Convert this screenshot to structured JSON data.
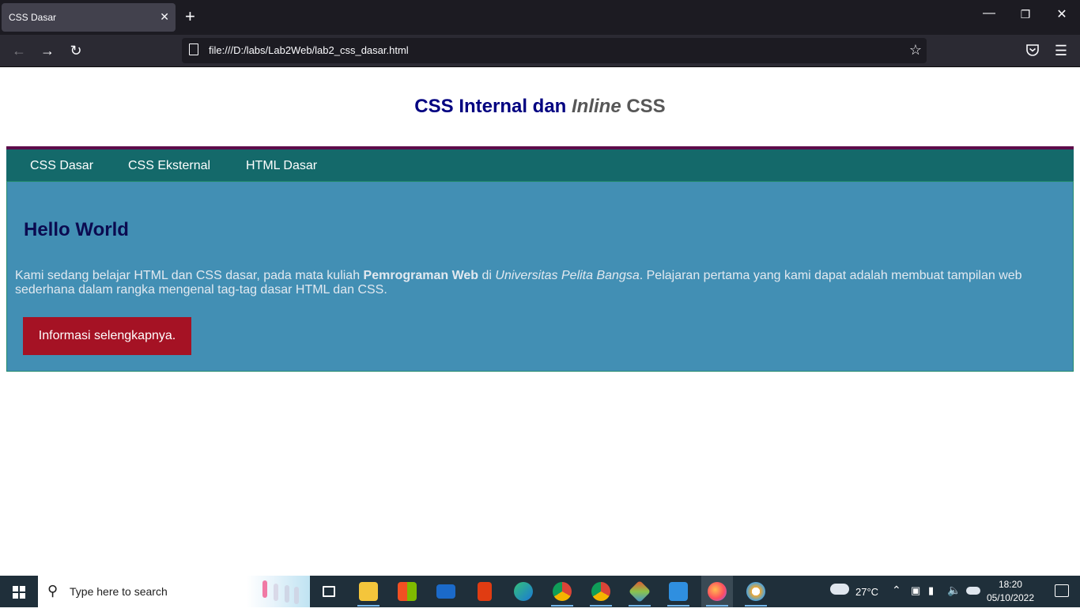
{
  "browser": {
    "tab_title": "CSS Dasar",
    "tab_close": "✕",
    "new_tab": "+",
    "url": "file:///D:/labs/Lab2Web/lab2_css_dasar.html",
    "icons": [
      "back-icon",
      "forward-icon",
      "reload-icon",
      "page-icon",
      "star-icon",
      "pocket-icon",
      "menu-icon",
      "minimize-icon",
      "restore-icon",
      "close-icon"
    ]
  },
  "page": {
    "heading_part1": "CSS Internal dan ",
    "heading_italic": "Inline",
    "heading_part2": " CSS",
    "menu": [
      {
        "label": "CSS Dasar"
      },
      {
        "label": "CSS Eksternal"
      },
      {
        "label": "HTML Dasar"
      }
    ],
    "content": {
      "title": "Hello World",
      "text_1": "Kami sedang belajar HTML dan CSS dasar, pada mata kuliah ",
      "text_bold": "Pemrograman Web",
      "text_2": " di ",
      "text_italic": "Universitas Pelita Bangsa",
      "text_3": ". Pelajaran pertama yang kami dapat adalah membuat tampilan web sederhana dalam rangka mengenal tag-tag dasar HTML dan CSS.",
      "button_label": "Informasi selengkapnya."
    },
    "colors": {
      "heading": "#000080",
      "menu_bg": "#14696a",
      "menu_border": "#5d0c4b",
      "content_bg": "#428fb4",
      "button_bg": "#a51224"
    }
  },
  "taskbar": {
    "search_placeholder": "Type here to search",
    "weather": "27°C",
    "time": "18:20",
    "date": "05/10/2022",
    "apps": [
      "task-view-icon",
      "file-explorer-icon",
      "microsoft-store-icon",
      "mail-icon",
      "office-icon",
      "edge-icon",
      "chrome-icon",
      "chrome-profile-icon",
      "git-icon",
      "vscode-icon",
      "firefox-icon",
      "paint-icon"
    ]
  }
}
